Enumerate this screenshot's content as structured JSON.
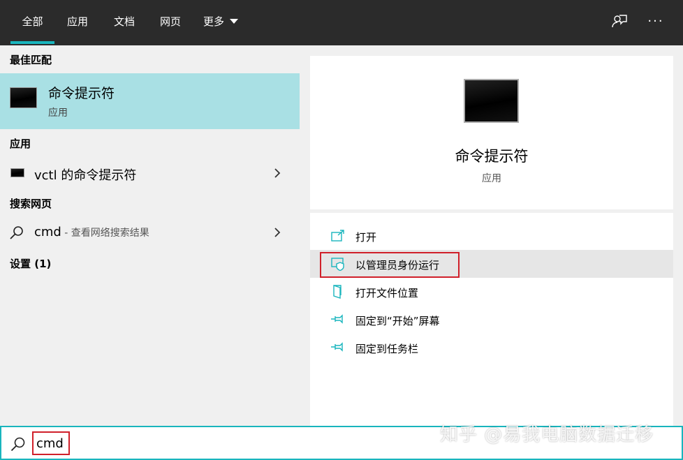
{
  "tabs": {
    "all": "全部",
    "apps": "应用",
    "documents": "文档",
    "web": "网页",
    "more": "更多"
  },
  "top_icons": [
    "feedback-icon",
    "more-options-icon"
  ],
  "more_dots": "···",
  "left": {
    "best_match_header": "最佳匹配",
    "best_match": {
      "title": "命令提示符",
      "subtitle": "应用"
    },
    "apps_header": "应用",
    "app_result": "vctl 的命令提示符",
    "web_header": "搜索网页",
    "web_result": {
      "query": "cmd",
      "suffix": " - 查看网络搜索结果"
    },
    "settings_header": "设置 (1)"
  },
  "preview": {
    "title": "命令提示符",
    "subtitle": "应用"
  },
  "actions": [
    {
      "label": "打开",
      "icon": "open-icon"
    },
    {
      "label": "以管理员身份运行",
      "icon": "shield-icon"
    },
    {
      "label": "打开文件位置",
      "icon": "folder-icon"
    },
    {
      "label": "固定到“开始”屏幕",
      "icon": "pin-icon"
    },
    {
      "label": "固定到任务栏",
      "icon": "pin-icon"
    }
  ],
  "search": {
    "value": "cmd"
  },
  "watermark": "知乎 @易我电脑数据迁移",
  "colors": {
    "accent": "#19b5bd",
    "selection": "#a9e0e4",
    "highlight_box": "#d0202a",
    "topbar": "#2b2b2b"
  }
}
